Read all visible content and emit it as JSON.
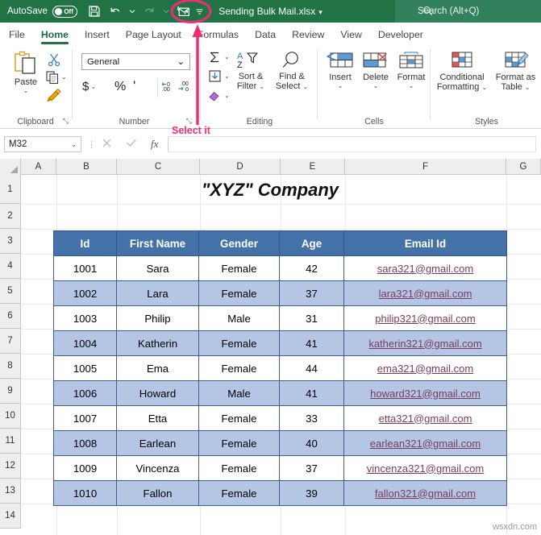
{
  "titlebar": {
    "autosave_label": "AutoSave",
    "autosave_state": "Off",
    "save_icon": "save-icon",
    "undo_icon": "undo-icon",
    "redo_icon": "redo-icon",
    "email_icon": "send-as-email-icon",
    "customize_qat_icon": "customize-quick-access-toolbar-icon",
    "document_title": "Sending Bulk Mail.xlsx",
    "title_caret": "▾",
    "search_placeholder": "Search (Alt+Q)",
    "search_icon": "search-icon"
  },
  "tabs": [
    {
      "label": "File",
      "active": false
    },
    {
      "label": "Home",
      "active": true
    },
    {
      "label": "Insert",
      "active": false
    },
    {
      "label": "Page Layout",
      "active": false
    },
    {
      "label": "Formulas",
      "active": false
    },
    {
      "label": "Data",
      "active": false
    },
    {
      "label": "Review",
      "active": false
    },
    {
      "label": "View",
      "active": false
    },
    {
      "label": "Developer",
      "active": false
    }
  ],
  "ribbon": {
    "clipboard": {
      "group_label": "Clipboard",
      "paste_label": "Paste",
      "paste_caret": "⌄",
      "cut_icon": "scissors-icon",
      "copy_icon": "copy-icon",
      "format_painter_icon": "format-painter-icon",
      "dialog_launcher": "⤡"
    },
    "number": {
      "group_label": "Number",
      "format_value": "General",
      "format_caret": "⌄",
      "currency_label": "$",
      "currency_caret": "⌄",
      "percent_label": "%",
      "comma_label": "'",
      "increase_decimal_icon": "increase-decimal-icon",
      "decrease_decimal_icon": "decrease-decimal-icon",
      "dialog_launcher": "⤡"
    },
    "editing": {
      "group_label": "Editing",
      "autosum_icon": "autosum-sigma-icon",
      "autosum_caret": "⌄",
      "fill_icon": "fill-down-icon",
      "fill_caret": "⌄",
      "clear_icon": "clear-eraser-icon",
      "clear_caret": "⌄",
      "sort_filter_line1": "Sort &",
      "sort_filter_line2": "Filter",
      "sort_filter_caret": "⌄",
      "find_select_line1": "Find &",
      "find_select_line2": "Select",
      "find_select_caret": "⌄"
    },
    "cells": {
      "group_label": "Cells",
      "insert_label": "Insert",
      "delete_label": "Delete",
      "format_label": "Format",
      "caret": "⌄"
    },
    "styles": {
      "group_label": "Styles",
      "conditional_line1": "Conditional",
      "conditional_line2": "Formatting",
      "conditional_caret": "⌄",
      "format_table_line1": "Format as",
      "format_table_line2": "Table",
      "format_table_caret": "⌄"
    }
  },
  "formula_bar": {
    "name_box_value": "M32",
    "name_box_caret": "⌄",
    "cancel_icon": "cancel-x-icon",
    "confirm_icon": "confirm-check-icon",
    "function_icon": "insert-function-fx-icon",
    "fx_label": "fx",
    "formula_value": ""
  },
  "grid": {
    "columns": [
      "A",
      "B",
      "C",
      "D",
      "E",
      "F",
      "G"
    ],
    "rows": [
      "1",
      "2",
      "3",
      "4",
      "5",
      "6",
      "7",
      "8",
      "9",
      "10",
      "11",
      "12",
      "13",
      "14"
    ],
    "sheet_title": "\"XYZ\" Company"
  },
  "table": {
    "headers": [
      "Id",
      "First Name",
      "Gender",
      "Age",
      "Email Id"
    ],
    "rows": [
      {
        "id": "1001",
        "name": "Sara",
        "gender": "Female",
        "age": "42",
        "email": "sara321@gmail.com"
      },
      {
        "id": "1002",
        "name": "Lara",
        "gender": "Female",
        "age": "37",
        "email": "lara321@gmail.com"
      },
      {
        "id": "1003",
        "name": "Philip",
        "gender": "Male",
        "age": "31",
        "email": "philip321@gmail.com"
      },
      {
        "id": "1004",
        "name": "Katherin",
        "gender": "Female",
        "age": "41",
        "email": "katherin321@gmail.com"
      },
      {
        "id": "1005",
        "name": "Ema",
        "gender": "Female",
        "age": "44",
        "email": "ema321@gmail.com"
      },
      {
        "id": "1006",
        "name": "Howard",
        "gender": "Male",
        "age": "41",
        "email": "howard321@gmail.com"
      },
      {
        "id": "1007",
        "name": "Etta",
        "gender": "Female",
        "age": "33",
        "email": "etta321@gmail.com"
      },
      {
        "id": "1008",
        "name": "Earlean",
        "gender": "Female",
        "age": "40",
        "email": "earlean321@gmail.com"
      },
      {
        "id": "1009",
        "name": "Vincenza",
        "gender": "Female",
        "age": "37",
        "email": "vincenza321@gmail.com"
      },
      {
        "id": "1010",
        "name": "Fallon",
        "gender": "Female",
        "age": "39",
        "email": "fallon321@gmail.com"
      }
    ]
  },
  "annotation": {
    "text": "Select it",
    "color": "#ef2c76",
    "highlight_shape": "ellipse",
    "arrow": "arrow-up"
  },
  "watermark": {
    "text": "wsxdn.com"
  },
  "colors": {
    "ribbon_green": "#217346",
    "search_green": "#33815c",
    "table_header_blue": "#4472a8",
    "table_band_blue": "#b4c6e4",
    "email_link": "#7a3b5e",
    "annotation_pink": "#ef2c76"
  }
}
